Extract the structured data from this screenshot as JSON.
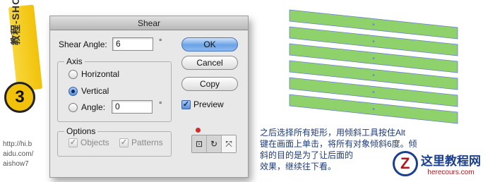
{
  "side_tab": {
    "vertical_text": "教程-SHOW酱",
    "step_number": "3"
  },
  "credit": {
    "lines": [
      "http://hi.b",
      "aidu.com/",
      "aishow7"
    ]
  },
  "dialog": {
    "title": "Shear",
    "shear_angle_label": "Shear Angle:",
    "shear_angle_value": "6",
    "degree_symbol": "°",
    "axis": {
      "group_label": "Axis",
      "horizontal_label": "Horizontal",
      "vertical_label": "Vertical",
      "angle_label": "Angle:",
      "angle_value": "0",
      "selected": "vertical"
    },
    "options": {
      "group_label": "Options",
      "objects_label": "Objects",
      "patterns_label": "Patterns"
    },
    "buttons": {
      "ok": "OK",
      "cancel": "Cancel",
      "copy": "Copy"
    },
    "preview_label": "Preview",
    "preview_checked": true
  },
  "canvas": {
    "rect_fill": "#8fd16a",
    "rect_stroke": "#6a7fd1",
    "rect_count": 6
  },
  "caption": {
    "lines": [
      "之后选择所有矩形，用倾斜工具按住Alt",
      "键在画面上单击，将所有对象倾斜6度。倾",
      "斜的目的是为了让后面的",
      "效果，继续往下看。"
    ]
  },
  "logo": {
    "cn": "这里教程网",
    "en": "herecours.com"
  },
  "colors": {
    "accent_blue": "#6aa2e6",
    "tab_yellow": "#f2c20a",
    "caption_blue": "#1e3a78"
  }
}
